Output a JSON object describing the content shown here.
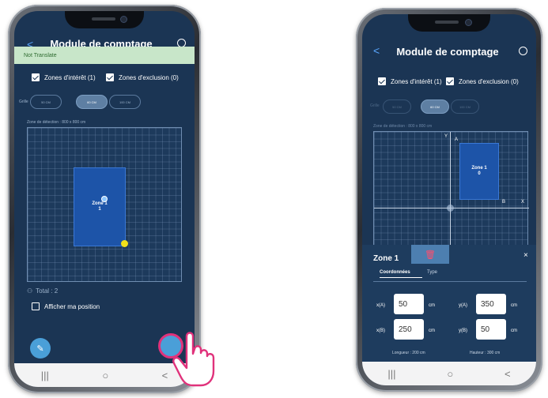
{
  "left_phone": {
    "title": "Module de comptage",
    "banner": "Not Translate",
    "checkbox_interest": "Zones d'intérêt (1)",
    "checkbox_exclusion": "Zones d'exclusion (0)",
    "grid_label": "Grille",
    "grid_options": [
      "50 CM",
      "60 CM",
      "100 CM"
    ],
    "grid_selected": "60 CM",
    "detection_label": "Zone de détection : 800 x 800 cm",
    "zone_name": "Zone 1",
    "zone_index": "1",
    "total_label": "Total : 2",
    "show_position": "Afficher ma position",
    "nav": [
      "|||",
      "○",
      "<"
    ]
  },
  "right_phone": {
    "title": "Module de comptage",
    "checkbox_interest": "Zones d'intérêt (1)",
    "checkbox_exclusion": "Zones d'exclusion (0)",
    "grid_label": "Grille",
    "grid_options": [
      "50 CM",
      "60 CM",
      "100 CM"
    ],
    "detection_label": "Zone de détection : 800 x 800 cm",
    "zone_name": "Zone 1",
    "zone_index": "0",
    "axis_y": "Y",
    "axis_x": "X",
    "point_a": "A",
    "point_b": "B",
    "panel_title": "Zone 1",
    "tab_coords": "Coordonnées",
    "tab_type": "Type",
    "close": "×",
    "xA_label": "x(A)",
    "xA": "50",
    "yA_label": "y(A)",
    "yA": "350",
    "xB_label": "x(B)",
    "xB": "250",
    "yB_label": "y(B)",
    "yB": "50",
    "unit": "cm",
    "length": "Longueur : 200 cm",
    "height": "Hauteur : 300 cm",
    "nav": [
      "|||",
      "○",
      "<"
    ]
  },
  "colors": {
    "screen_bg": "#1b3554",
    "zone": "#1d54a8",
    "banner": "#c8e6c9",
    "fab": "#4a9fd8",
    "delete_btn": "#4d7fb0",
    "handle": "#f2e11a"
  }
}
